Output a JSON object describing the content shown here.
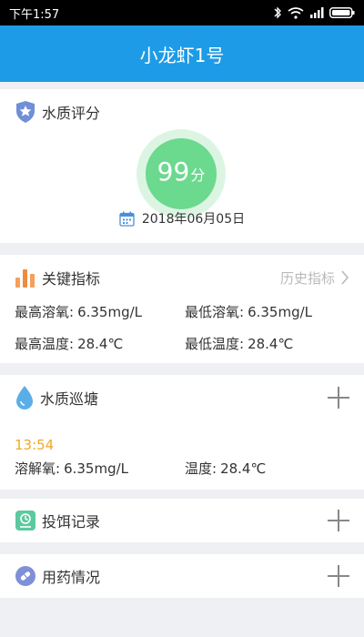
{
  "status_bar": {
    "time": "下午1:57"
  },
  "app": {
    "title": "小龙虾1号"
  },
  "water_score": {
    "title": "水质评分",
    "score": "99",
    "unit": "分",
    "date": "2018年06月05日"
  },
  "key_metrics": {
    "title": "关键指标",
    "history_label": "历史指标",
    "items": [
      {
        "label": "最高溶氧:",
        "value": "6.35mg/L"
      },
      {
        "label": "最低溶氧:",
        "value": "6.35mg/L"
      },
      {
        "label": "最高温度:",
        "value": "28.4℃"
      },
      {
        "label": "最低温度:",
        "value": "28.4℃"
      }
    ]
  },
  "patrol": {
    "title": "水质巡塘",
    "time": "13:54",
    "items": [
      {
        "label": "溶解氧:",
        "value": "6.35mg/L"
      },
      {
        "label": "温度:",
        "value": "28.4℃"
      }
    ]
  },
  "feeding": {
    "title": "投饵记录"
  },
  "medication": {
    "title": "用药情况"
  },
  "colors": {
    "accent": "#1e9be6",
    "score_green": "#6bd98e",
    "patrol_time": "#f5a623"
  }
}
